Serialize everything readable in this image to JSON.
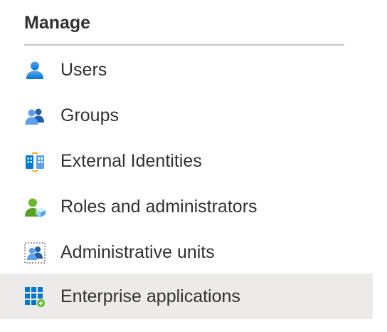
{
  "section": {
    "title": "Manage"
  },
  "items": [
    {
      "label": "Users",
      "icon": "user-icon",
      "selected": false
    },
    {
      "label": "Groups",
      "icon": "groups-icon",
      "selected": false
    },
    {
      "label": "External Identities",
      "icon": "external-identities-icon",
      "selected": false
    },
    {
      "label": "Roles and administrators",
      "icon": "roles-icon",
      "selected": false
    },
    {
      "label": "Administrative units",
      "icon": "administrative-units-icon",
      "selected": false
    },
    {
      "label": "Enterprise applications",
      "icon": "enterprise-apps-icon",
      "selected": true
    }
  ],
  "colors": {
    "selected_background": "#edebe9",
    "divider": "#c8c6c4",
    "text": "#323130",
    "icon_blue": "#0078d4"
  }
}
